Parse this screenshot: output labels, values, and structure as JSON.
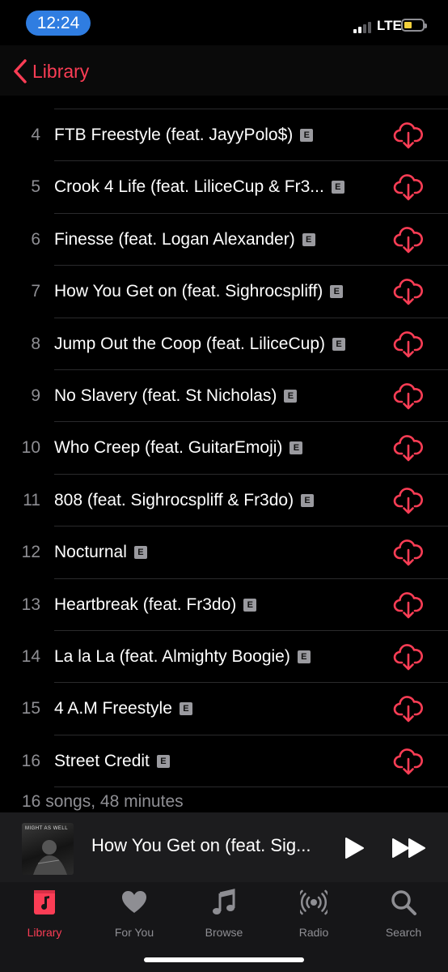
{
  "status": {
    "time": "12:24",
    "network": "LTE"
  },
  "nav": {
    "back_label": "Library"
  },
  "tracks": [
    {
      "num": "4",
      "title": "FTB Freestyle (feat. JayyPolo$)"
    },
    {
      "num": "5",
      "title": "Crook 4 Life (feat. LiliceCup & Fr3..."
    },
    {
      "num": "6",
      "title": "Finesse (feat. Logan Alexander)"
    },
    {
      "num": "7",
      "title": "How You Get on (feat. Sighrocspliff)"
    },
    {
      "num": "8",
      "title": "Jump Out the Coop (feat. LiliceCup)"
    },
    {
      "num": "9",
      "title": "No Slavery (feat. St Nicholas)"
    },
    {
      "num": "10",
      "title": "Who Creep (feat. GuitarEmoji)"
    },
    {
      "num": "11",
      "title": "808 (feat. Sighrocspliff & Fr3do)"
    },
    {
      "num": "12",
      "title": "Nocturnal"
    },
    {
      "num": "13",
      "title": "Heartbreak (feat. Fr3do)"
    },
    {
      "num": "14",
      "title": "La la La (feat. Almighty Boogie)"
    },
    {
      "num": "15",
      "title": "4 A.M Freestyle"
    },
    {
      "num": "16",
      "title": "Street Credit"
    }
  ],
  "explicit_badge": "E",
  "summary": "16 songs, 48 minutes",
  "now_playing": {
    "title": "How You Get on (feat. Sig...",
    "artwork_text": "MIGHT AS WELL"
  },
  "tabs": [
    {
      "label": "Library",
      "icon": "library-icon",
      "active": true
    },
    {
      "label": "For You",
      "icon": "heart-icon"
    },
    {
      "label": "Browse",
      "icon": "music-note-icon"
    },
    {
      "label": "Radio",
      "icon": "radio-icon"
    },
    {
      "label": "Search",
      "icon": "search-icon"
    }
  ],
  "colors": {
    "accent": "#fb3d55",
    "secondary_text": "#8e8e93",
    "time_pill": "#2f7de1"
  }
}
